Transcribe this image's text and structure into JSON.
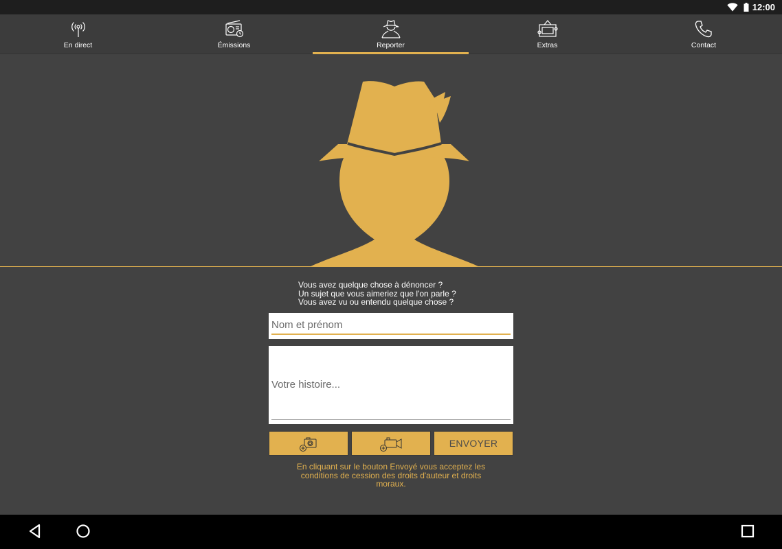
{
  "status_bar": {
    "time": "12:00"
  },
  "tabs": [
    {
      "label": "En direct",
      "icon": "antenna-icon",
      "active": false
    },
    {
      "label": "Émissions",
      "icon": "radio-icon",
      "active": false
    },
    {
      "label": "Reporter",
      "icon": "reporter-icon",
      "active": true
    },
    {
      "label": "Extras",
      "icon": "ticket-icon",
      "active": false
    },
    {
      "label": "Contact",
      "icon": "phone-icon",
      "active": false
    }
  ],
  "colors": {
    "accent": "#e2b14f",
    "background": "#424242",
    "tabbar": "#3c3c3c"
  },
  "intro": {
    "line1": "Vous avez quelque chose à dénoncer ?",
    "line2": "Un sujet que vous aimeriez que l'on parle ?",
    "line3": "Vous avez vu ou entendu quelque chose ?"
  },
  "form": {
    "name_placeholder": "Nom et prénom",
    "name_value": "",
    "story_placeholder": "Votre histoire...",
    "story_value": "",
    "photo_button_icon": "add-photo-icon",
    "video_button_icon": "add-video-icon",
    "send_label": "ENVOYER"
  },
  "terms": {
    "line1": "En cliquant sur le bouton Envoyé vous acceptez les",
    "line2": "conditions de cession des droits d'auteur et droits",
    "line3": "moraux."
  },
  "nav_bar": {
    "back_icon": "back-icon",
    "home_icon": "home-icon",
    "recents_icon": "recents-icon"
  }
}
